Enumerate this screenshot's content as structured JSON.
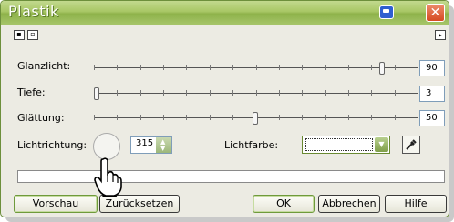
{
  "window": {
    "title": "Plastik",
    "close_glyph": "✕",
    "app_icon": "window-icon"
  },
  "toolbar": {
    "left_icons": [
      "panel-icon",
      "layout-icon"
    ],
    "right_icon": "expand-arrow-icon"
  },
  "sliders": [
    {
      "label": "Glanzlicht:",
      "value": "90",
      "position": 0.9
    },
    {
      "label": "Tiefe:",
      "value": "3",
      "position": 0.0
    },
    {
      "label": "Glättung:",
      "value": "50",
      "position": 0.5
    }
  ],
  "light": {
    "direction_label": "Lichtrichtung:",
    "direction_value": "315",
    "color_label": "Lichtfarbe:"
  },
  "buttons": {
    "preview": "Vorschau",
    "reset": "Zurücksetzen",
    "ok": "OK",
    "cancel": "Abbrechen",
    "help": "Hilfe"
  },
  "colors": {
    "titlebar": "#a8c765",
    "accent": "#6f9a3c",
    "close": "#d64a22"
  }
}
